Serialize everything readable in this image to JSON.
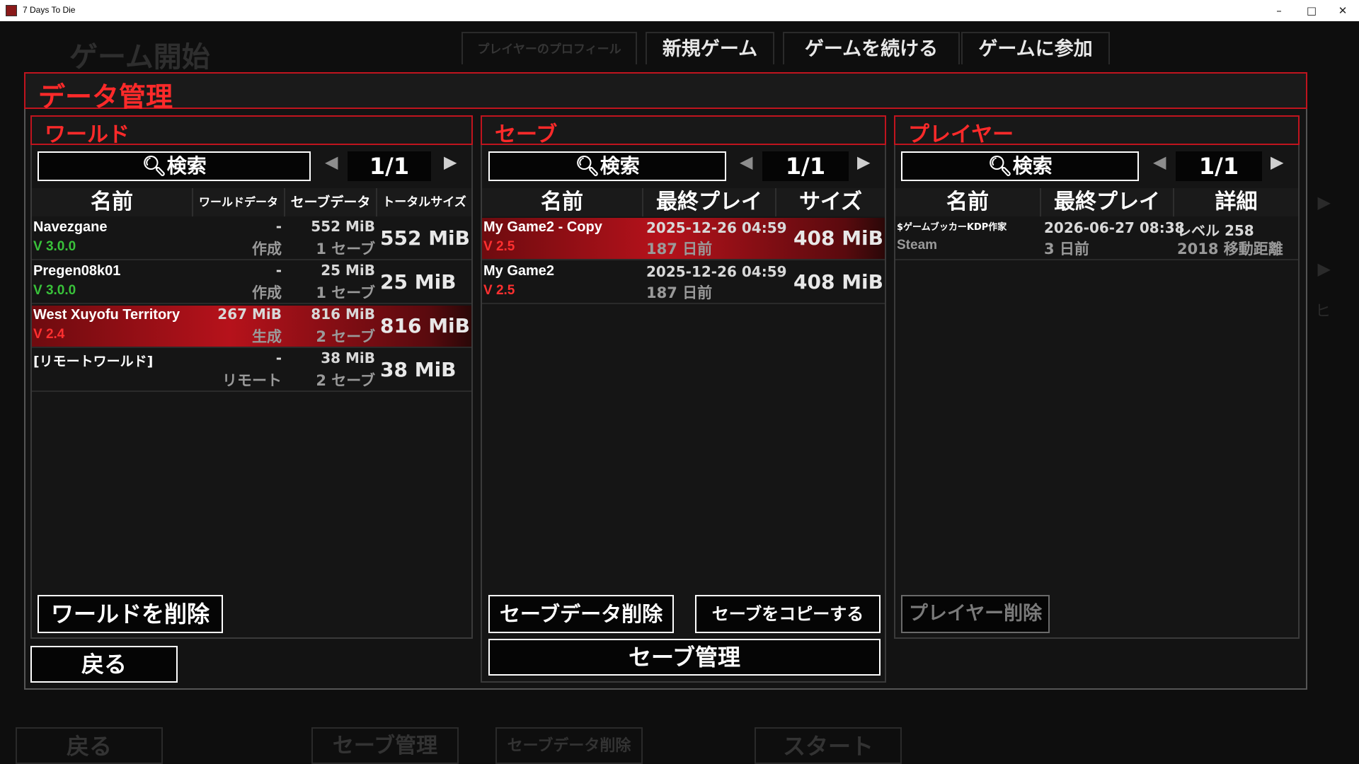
{
  "window": {
    "title": "7 Days To Die",
    "minimize": "–",
    "maximize": "□",
    "close": "✕"
  },
  "background_menu": {
    "title": "ゲーム開始",
    "tabs": [
      "プレイヤーのプロフィール",
      "新規ゲーム",
      "ゲームを続ける",
      "ゲームに参加"
    ],
    "bottom_buttons": [
      "戻る",
      "セーブ管理",
      "セーブデータ削除",
      "スタート"
    ],
    "side_text": "ヒ"
  },
  "modal": {
    "title": "データ管理",
    "back_label": "戻る"
  },
  "worlds": {
    "title": "ワールド",
    "search_label": "検索",
    "page": "1/1",
    "columns": [
      "名前",
      "ワールドデータ",
      "セーブデータ",
      "トータルサイズ"
    ],
    "rows": [
      {
        "name": "Navezgane",
        "version": "V 3.0.0",
        "version_color": "green",
        "world_size": "-",
        "world_status": "作成",
        "save_size": "552 MiB",
        "save_count": "1 セーブ",
        "total": "552 MiB",
        "selected": false
      },
      {
        "name": "Pregen08k01",
        "version": "V 3.0.0",
        "version_color": "green",
        "world_size": "-",
        "world_status": "作成",
        "save_size": "25 MiB",
        "save_count": "1 セーブ",
        "total": "25 MiB",
        "selected": false
      },
      {
        "name": "West Xuyofu Territory",
        "version": "V 2.4",
        "version_color": "red",
        "world_size": "267 MiB",
        "world_status": "生成",
        "save_size": "816 MiB",
        "save_count": "2 セーブ",
        "total": "816 MiB",
        "selected": true
      },
      {
        "name": "[リモートワールド]",
        "version": "",
        "version_color": "green",
        "world_size": "-",
        "world_status": "リモート",
        "save_size": "38 MiB",
        "save_count": "2 セーブ",
        "total": "38 MiB",
        "selected": false
      }
    ],
    "delete_label": "ワールドを削除"
  },
  "saves": {
    "title": "セーブ",
    "search_label": "検索",
    "page": "1/1",
    "columns": [
      "名前",
      "最終プレイ",
      "サイズ"
    ],
    "rows": [
      {
        "name": "My Game2 - Copy",
        "version": "V 2.5",
        "last_played": "2025-12-26 04:59",
        "ago": "187 日前",
        "size": "408 MiB",
        "selected": true
      },
      {
        "name": "My Game2",
        "version": "V 2.5",
        "last_played": "2025-12-26 04:59",
        "ago": "187 日前",
        "size": "408 MiB",
        "selected": false
      }
    ],
    "delete_label": "セーブデータ削除",
    "copy_label": "セーブをコピーする",
    "manage_label": "セーブ管理"
  },
  "players": {
    "title": "プレイヤー",
    "search_label": "検索",
    "page": "1/1",
    "columns": [
      "名前",
      "最終プレイ",
      "詳細"
    ],
    "rows": [
      {
        "name": "$ゲームブッカーKDP作家",
        "platform": "Steam",
        "last_played": "2026-06-27 08:38",
        "ago": "3 日前",
        "level": "レベル 258",
        "distance": "2018 移動距離"
      }
    ],
    "delete_label": "プレイヤー削除"
  },
  "colors": {
    "accent_red": "#ff2a2a",
    "frame_red": "#c0141e",
    "version_green": "#39c23a",
    "selected_row": "#b6121b"
  }
}
